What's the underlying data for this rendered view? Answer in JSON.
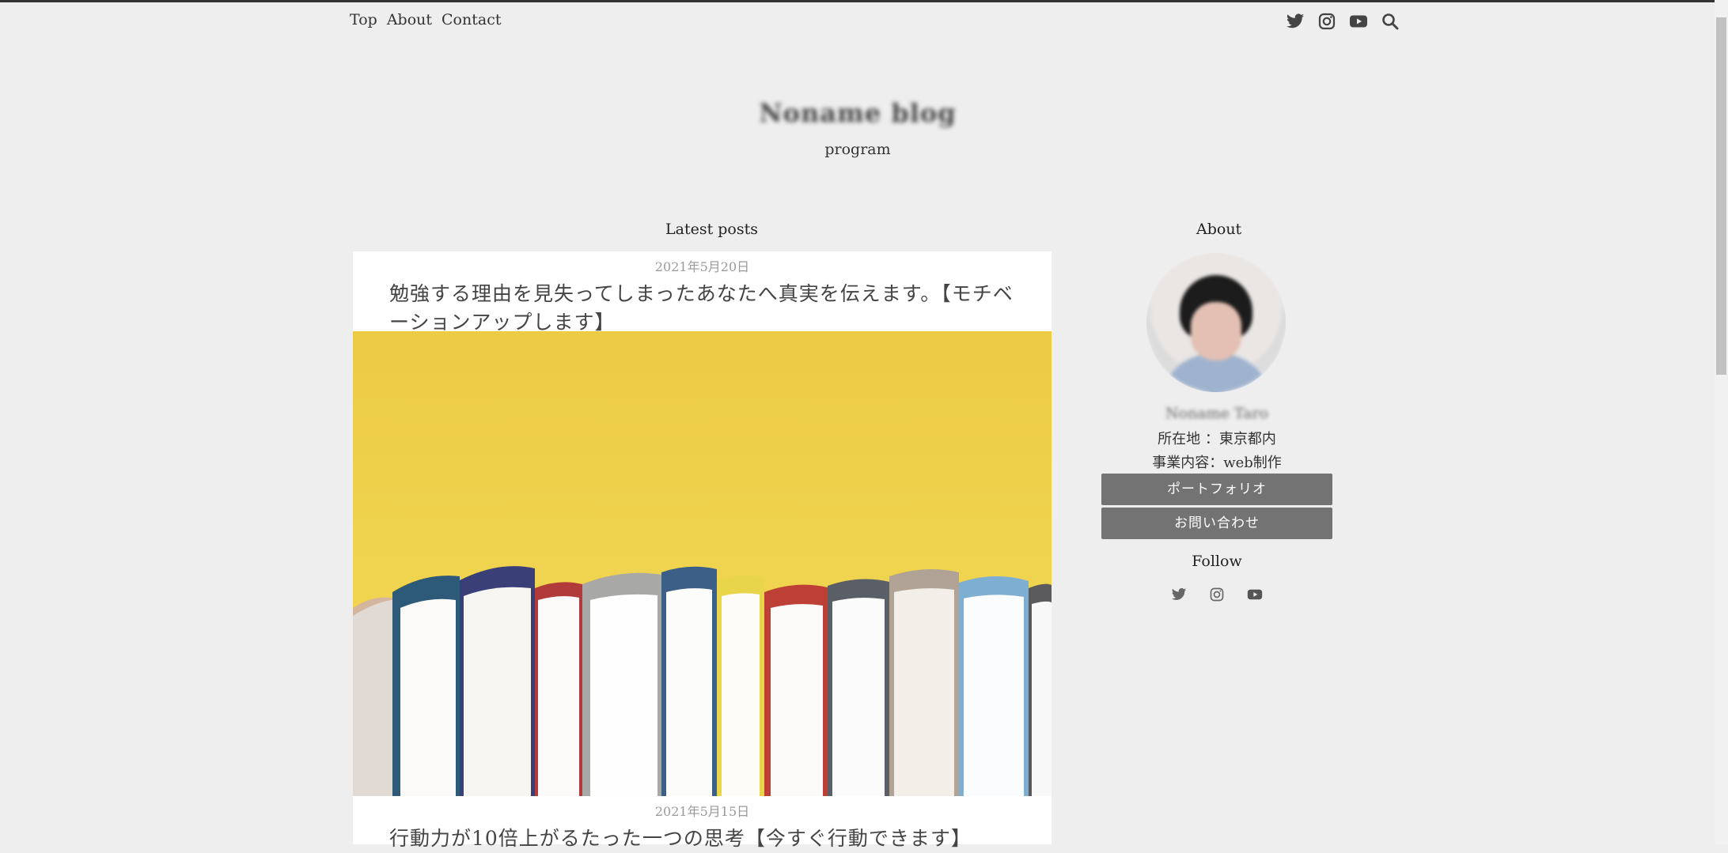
{
  "nav": {
    "items": [
      "Top",
      "About",
      "Contact"
    ]
  },
  "header_icons": [
    "twitter-icon",
    "instagram-icon",
    "youtube-icon",
    "search-icon"
  ],
  "site": {
    "title": "Noname blog",
    "tagline": "program"
  },
  "main": {
    "section_title": "Latest posts",
    "posts": [
      {
        "date": "2021年5月20日",
        "title": "勉強する理由を見失ってしまったあなたへ真実を伝えます。【モチベーションアップします】"
      },
      {
        "date": "2021年5月15日",
        "title": "行動力が10倍上がるたった一つの思考【今すぐ行動できます】"
      }
    ]
  },
  "sidebar": {
    "about_title": "About",
    "profile_name": "Noname Taro",
    "location": "所在地 ：東京都内",
    "business": "事業内容：web制作",
    "buttons": [
      "ポートフォリオ",
      "お問い合わせ"
    ],
    "follow_title": "Follow",
    "follow_icons": [
      "twitter-icon",
      "instagram-icon",
      "youtube-icon"
    ]
  },
  "colors": {
    "background": "#eeeeee",
    "button": "#737373",
    "thumbnail": "#f0d54c"
  }
}
